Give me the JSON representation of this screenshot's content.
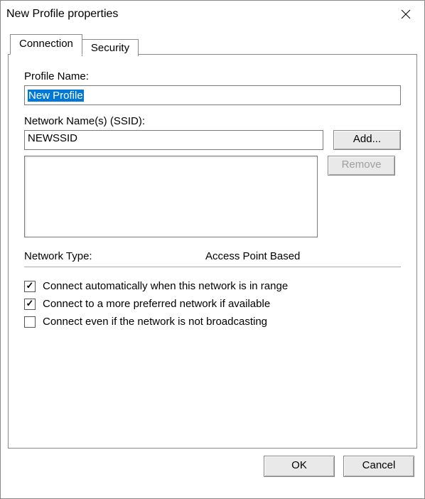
{
  "window": {
    "title": "New Profile properties"
  },
  "tabs": {
    "connection": "Connection",
    "security": "Security"
  },
  "connection": {
    "profile_name_label": "Profile Name:",
    "profile_name_value": "New Profile",
    "ssid_label": "Network Name(s) (SSID):",
    "ssid_value": "NEWSSID",
    "add_button": "Add...",
    "remove_button": "Remove",
    "network_type_label": "Network Type:",
    "network_type_value": "Access Point Based",
    "auto_connect": "Connect automatically when this network is in range",
    "prefer_connect": "Connect to a more preferred network if available",
    "hidden_connect": "Connect even if the network is not broadcasting",
    "auto_connect_checked": true,
    "prefer_connect_checked": true,
    "hidden_connect_checked": false
  },
  "buttons": {
    "ok": "OK",
    "cancel": "Cancel"
  }
}
